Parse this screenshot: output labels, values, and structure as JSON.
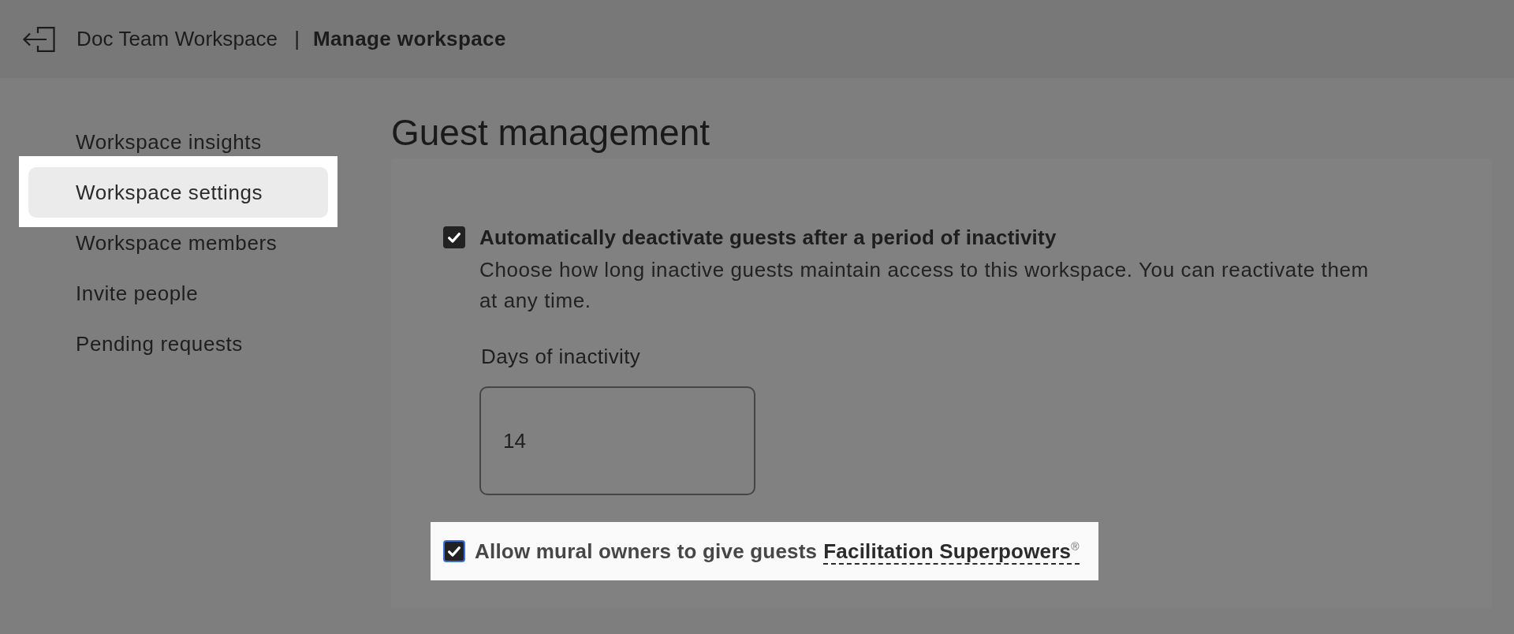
{
  "header": {
    "workspace": "Doc Team Workspace",
    "separator": "|",
    "page_title": "Manage workspace"
  },
  "sidebar": {
    "items": [
      {
        "label": "Workspace insights",
        "selected": false,
        "spotlight": false
      },
      {
        "label": "Workspace settings",
        "selected": true,
        "spotlight": true
      },
      {
        "label": "Workspace members",
        "selected": false,
        "spotlight": false
      },
      {
        "label": "Invite people",
        "selected": false,
        "spotlight": false
      },
      {
        "label": "Pending requests",
        "selected": false,
        "spotlight": false
      }
    ]
  },
  "main": {
    "heading": "Guest management",
    "settings": [
      {
        "kind": "detailed",
        "label": "Automatically deactivate guests after a period of inactivity",
        "checked": true,
        "focused": false,
        "spotlight": false,
        "description": "Choose how long inactive guests maintain access to this workspace. You can reactivate them at any time.",
        "field": {
          "label": "Days of inactivity",
          "value": "14"
        }
      },
      {
        "kind": "inline",
        "label": "Allow mural owners to give guests",
        "link": "Facilitation Superpowers$^{®}$",
        "checked": true,
        "focused": true,
        "spotlight": true
      }
    ]
  }
}
